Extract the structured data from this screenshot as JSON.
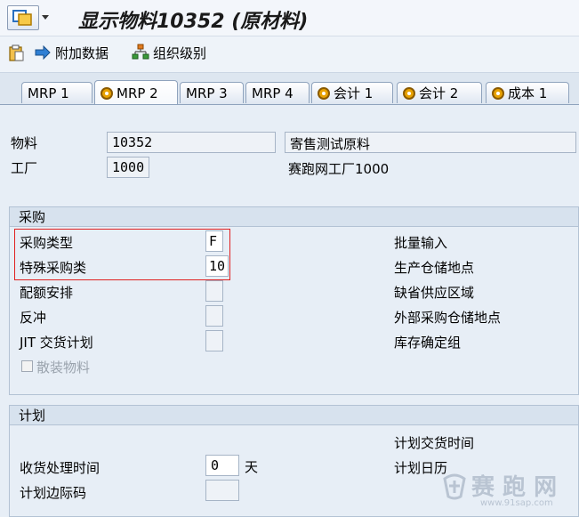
{
  "title": "显示物料10352 (原材料)",
  "toolbar": {
    "additional_data": "附加数据",
    "org_levels": "组织级别"
  },
  "tabs": [
    "MRP 1",
    "MRP 2",
    "MRP 3",
    "MRP 4",
    "会计 1",
    "会计 2",
    "成本 1"
  ],
  "header": {
    "material_label": "物料",
    "material_value": "10352",
    "material_desc": "寄售测试原料",
    "plant_label": "工厂",
    "plant_value": "1000",
    "plant_desc": "赛跑网工厂1000"
  },
  "procurement": {
    "title": "采购",
    "proc_type_label": "采购类型",
    "proc_type_value": "F",
    "special_proc_label": "特殊采购类",
    "special_proc_value": "10",
    "quota_label": "配额安排",
    "backflush_label": "反冲",
    "jit_label": "JIT 交货计划",
    "bulk_label": "散装物料",
    "batch_entry_label": "批量输入",
    "prod_sloc_label": "生产仓储地点",
    "default_supply_label": "缺省供应区域",
    "ext_sloc_label": "外部采购仓储地点",
    "stock_det_label": "库存确定组"
  },
  "planning": {
    "title": "计划",
    "gr_time_label": "收货处理时间",
    "gr_time_value": "0",
    "gr_time_unit": "天",
    "safety_key_label": "计划边际码",
    "plan_delivery_label": "计划交货时间",
    "plan_calendar_label": "计划日历"
  },
  "watermark": {
    "text": "赛 跑 网",
    "url": "www.91sap.com"
  }
}
